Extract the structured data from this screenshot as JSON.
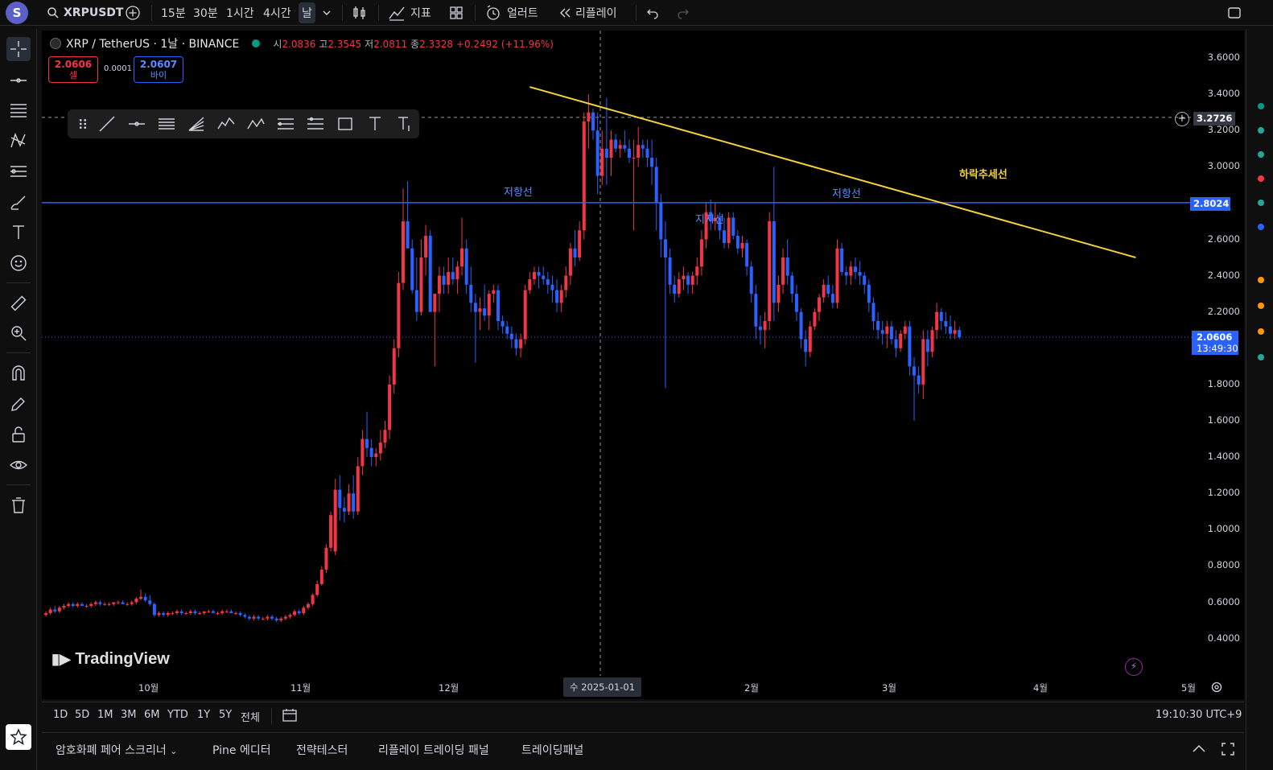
{
  "topbar": {
    "avatar": "S",
    "symbol": "XRPUSDT",
    "intervals": [
      "15분",
      "30분",
      "1시간",
      "4시간",
      "날"
    ],
    "indicators_label": "지표",
    "alert_label": "얼러트",
    "replay_label": "리플레이"
  },
  "legend": {
    "symbol": "XRP / TetherUS · 1날 · BINANCE",
    "open_label": "시",
    "open": "2.0836",
    "high_label": "고",
    "high": "2.3545",
    "low_label": "저",
    "low": "2.0811",
    "close_label": "종",
    "close": "2.3328",
    "change": "+0.2492 (+11.96%)"
  },
  "trade": {
    "sell_price": "2.0606",
    "sell_label": "셀",
    "spread": "0.0001",
    "buy_price": "2.0607",
    "buy_label": "바이"
  },
  "annotations": {
    "resistance_1": "저항선",
    "resistance_2": "저항선",
    "support": "지지선",
    "downtrend": "하락추세선"
  },
  "logo": "TradingView",
  "price_axis": [
    "3.6000",
    "3.4000",
    "3.2000",
    "3.0000",
    "2.6000",
    "2.4000",
    "2.2000",
    "1.8000",
    "1.6000",
    "1.4000",
    "1.2000",
    "1.0000",
    "0.8000",
    "0.6000",
    "0.4000"
  ],
  "price_badges": {
    "crosshair": "3.2726",
    "hline": "2.8024",
    "last": "2.0606",
    "countdown": "13:49:30"
  },
  "time_axis": [
    "10월",
    "11월",
    "12월",
    "수 2025-01-01",
    "2월",
    "3월",
    "4월",
    "5월"
  ],
  "ranges": [
    "1D",
    "5D",
    "1M",
    "3M",
    "6M",
    "YTD",
    "1Y",
    "5Y",
    "전체"
  ],
  "clock": "19:10:30 UTC+9",
  "bottom_tabs": [
    "암호화폐 페어 스크리너",
    "Pine 에디터",
    "전략테스터",
    "리플레이 트레이딩 패널",
    "트레이딩패널"
  ],
  "colors": {
    "up": "#f23645",
    "down": "#2962ff",
    "hline": "#2962ff",
    "trendline": "#f5d33c",
    "annotation_blue": "#5b8cff",
    "annotation_yellow": "#f5d33c"
  },
  "chart_data": {
    "type": "candlestick",
    "symbol": "XRP / TetherUS",
    "interval": "1D",
    "ylim": [
      0.3,
      3.75
    ],
    "horizontal_line": 2.8024,
    "trendline": {
      "from": {
        "t": 107,
        "price": 3.44
      },
      "to": {
        "t": 241,
        "price": 2.5
      }
    },
    "candles": [
      [
        0.53,
        0.55,
        0.52,
        0.54
      ],
      [
        0.54,
        0.57,
        0.53,
        0.56
      ],
      [
        0.56,
        0.58,
        0.54,
        0.55
      ],
      [
        0.55,
        0.58,
        0.54,
        0.57
      ],
      [
        0.57,
        0.59,
        0.56,
        0.58
      ],
      [
        0.58,
        0.6,
        0.57,
        0.59
      ],
      [
        0.59,
        0.6,
        0.57,
        0.58
      ],
      [
        0.58,
        0.6,
        0.57,
        0.59
      ],
      [
        0.59,
        0.6,
        0.58,
        0.58
      ],
      [
        0.58,
        0.59,
        0.57,
        0.58
      ],
      [
        0.58,
        0.6,
        0.57,
        0.59
      ],
      [
        0.59,
        0.61,
        0.58,
        0.6
      ],
      [
        0.6,
        0.61,
        0.58,
        0.59
      ],
      [
        0.59,
        0.6,
        0.58,
        0.59
      ],
      [
        0.59,
        0.6,
        0.58,
        0.59
      ],
      [
        0.59,
        0.6,
        0.58,
        0.6
      ],
      [
        0.6,
        0.61,
        0.59,
        0.6
      ],
      [
        0.6,
        0.61,
        0.59,
        0.59
      ],
      [
        0.59,
        0.6,
        0.58,
        0.59
      ],
      [
        0.59,
        0.61,
        0.58,
        0.6
      ],
      [
        0.6,
        0.63,
        0.59,
        0.62
      ],
      [
        0.62,
        0.67,
        0.61,
        0.63
      ],
      [
        0.63,
        0.65,
        0.6,
        0.61
      ],
      [
        0.61,
        0.64,
        0.58,
        0.59
      ],
      [
        0.59,
        0.6,
        0.52,
        0.53
      ],
      [
        0.53,
        0.55,
        0.52,
        0.54
      ],
      [
        0.54,
        0.55,
        0.52,
        0.53
      ],
      [
        0.53,
        0.55,
        0.52,
        0.54
      ],
      [
        0.54,
        0.55,
        0.53,
        0.54
      ],
      [
        0.54,
        0.56,
        0.53,
        0.55
      ],
      [
        0.55,
        0.56,
        0.53,
        0.54
      ],
      [
        0.54,
        0.55,
        0.53,
        0.54
      ],
      [
        0.54,
        0.56,
        0.53,
        0.55
      ],
      [
        0.55,
        0.56,
        0.53,
        0.54
      ],
      [
        0.54,
        0.55,
        0.53,
        0.54
      ],
      [
        0.54,
        0.55,
        0.53,
        0.55
      ],
      [
        0.55,
        0.56,
        0.54,
        0.55
      ],
      [
        0.55,
        0.56,
        0.54,
        0.54
      ],
      [
        0.54,
        0.55,
        0.53,
        0.54
      ],
      [
        0.54,
        0.56,
        0.53,
        0.55
      ],
      [
        0.55,
        0.56,
        0.54,
        0.55
      ],
      [
        0.55,
        0.56,
        0.54,
        0.54
      ],
      [
        0.54,
        0.55,
        0.53,
        0.54
      ],
      [
        0.54,
        0.55,
        0.52,
        0.53
      ],
      [
        0.53,
        0.54,
        0.51,
        0.52
      ],
      [
        0.52,
        0.53,
        0.5,
        0.51
      ],
      [
        0.51,
        0.53,
        0.5,
        0.52
      ],
      [
        0.52,
        0.53,
        0.5,
        0.51
      ],
      [
        0.51,
        0.52,
        0.5,
        0.51
      ],
      [
        0.51,
        0.53,
        0.5,
        0.52
      ],
      [
        0.52,
        0.53,
        0.5,
        0.51
      ],
      [
        0.51,
        0.52,
        0.49,
        0.5
      ],
      [
        0.5,
        0.52,
        0.49,
        0.51
      ],
      [
        0.51,
        0.53,
        0.5,
        0.52
      ],
      [
        0.52,
        0.54,
        0.51,
        0.53
      ],
      [
        0.53,
        0.56,
        0.52,
        0.55
      ],
      [
        0.55,
        0.56,
        0.53,
        0.54
      ],
      [
        0.54,
        0.58,
        0.53,
        0.57
      ],
      [
        0.57,
        0.6,
        0.56,
        0.59
      ],
      [
        0.59,
        0.65,
        0.58,
        0.64
      ],
      [
        0.64,
        0.72,
        0.63,
        0.7
      ],
      [
        0.7,
        0.8,
        0.69,
        0.78
      ],
      [
        0.78,
        0.92,
        0.76,
        0.9
      ],
      [
        0.9,
        1.1,
        0.88,
        1.08
      ],
      [
        0.88,
        1.28,
        0.86,
        1.22
      ],
      [
        1.22,
        1.3,
        1.05,
        1.12
      ],
      [
        1.12,
        1.18,
        1.04,
        1.1
      ],
      [
        1.1,
        1.25,
        1.08,
        1.2
      ],
      [
        1.2,
        1.3,
        1.06,
        1.1
      ],
      [
        1.1,
        1.4,
        1.08,
        1.35
      ],
      [
        1.35,
        1.55,
        1.3,
        1.5
      ],
      [
        1.5,
        1.65,
        1.4,
        1.45
      ],
      [
        1.45,
        1.5,
        1.35,
        1.4
      ],
      [
        1.4,
        1.45,
        1.35,
        1.42
      ],
      [
        1.42,
        1.55,
        1.38,
        1.48
      ],
      [
        1.48,
        1.6,
        1.45,
        1.55
      ],
      [
        1.55,
        1.85,
        1.5,
        1.8
      ],
      [
        1.8,
        2.05,
        1.75,
        2.0
      ],
      [
        2.0,
        2.42,
        1.95,
        2.36
      ],
      [
        2.36,
        2.88,
        2.32,
        2.7
      ],
      [
        2.7,
        2.92,
        2.58,
        2.55
      ],
      [
        2.55,
        2.6,
        2.3,
        2.32
      ],
      [
        2.32,
        2.5,
        2.15,
        2.2
      ],
      [
        2.2,
        2.6,
        2.18,
        2.5
      ],
      [
        2.5,
        2.68,
        2.4,
        2.62
      ],
      [
        2.62,
        2.65,
        2.2,
        2.2
      ],
      [
        2.2,
        2.3,
        1.9,
        2.3
      ],
      [
        2.3,
        2.45,
        2.2,
        2.4
      ],
      [
        2.4,
        2.45,
        2.3,
        2.35
      ],
      [
        2.35,
        2.5,
        2.3,
        2.42
      ],
      [
        2.42,
        2.5,
        2.35,
        2.38
      ],
      [
        2.38,
        2.48,
        2.3,
        2.45
      ],
      [
        2.45,
        2.72,
        2.4,
        2.55
      ],
      [
        2.55,
        2.6,
        2.3,
        2.35
      ],
      [
        2.35,
        2.45,
        2.2,
        2.25
      ],
      [
        2.25,
        2.3,
        1.92,
        2.2
      ],
      [
        2.2,
        2.28,
        2.1,
        2.22
      ],
      [
        2.22,
        2.35,
        2.15,
        2.18
      ],
      [
        2.18,
        2.32,
        2.1,
        2.3
      ],
      [
        2.3,
        2.35,
        2.25,
        2.32
      ],
      [
        2.32,
        2.35,
        2.1,
        2.15
      ],
      [
        2.15,
        2.18,
        2.08,
        2.12
      ],
      [
        2.12,
        2.15,
        2.05,
        2.08
      ],
      [
        2.08,
        2.12,
        2.0,
        2.05
      ],
      [
        2.05,
        2.08,
        1.96,
        2.0
      ],
      [
        2.0,
        2.08,
        1.95,
        2.05
      ],
      [
        2.05,
        2.35,
        2.02,
        2.32
      ],
      [
        2.32,
        2.42,
        2.3,
        2.38
      ],
      [
        2.38,
        2.45,
        2.35,
        2.42
      ],
      [
        2.42,
        2.45,
        2.33,
        2.4
      ],
      [
        2.4,
        2.45,
        2.35,
        2.38
      ],
      [
        2.38,
        2.42,
        2.3,
        2.35
      ],
      [
        2.35,
        2.4,
        2.25,
        2.32
      ],
      [
        2.32,
        2.38,
        2.2,
        2.25
      ],
      [
        2.25,
        2.35,
        2.2,
        2.32
      ],
      [
        2.32,
        2.45,
        2.28,
        2.4
      ],
      [
        2.4,
        2.58,
        2.35,
        2.55
      ],
      [
        2.55,
        2.65,
        2.45,
        2.5
      ],
      [
        2.5,
        2.7,
        2.48,
        2.65
      ],
      [
        2.65,
        3.3,
        2.6,
        3.25
      ],
      [
        3.25,
        3.4,
        3.1,
        3.3
      ],
      [
        3.3,
        3.32,
        3.15,
        3.2
      ],
      [
        3.2,
        3.3,
        2.85,
        2.95
      ],
      [
        2.95,
        3.2,
        2.9,
        3.1
      ],
      [
        3.1,
        3.38,
        2.9,
        3.05
      ],
      [
        3.05,
        3.2,
        2.95,
        3.15
      ],
      [
        3.15,
        3.18,
        3.08,
        3.1
      ],
      [
        3.1,
        3.15,
        3.05,
        3.12
      ],
      [
        3.12,
        3.2,
        3.08,
        3.1
      ],
      [
        3.1,
        3.15,
        3.02,
        3.05
      ],
      [
        3.05,
        3.15,
        2.65,
        3.05
      ],
      [
        3.05,
        3.22,
        3.0,
        3.12
      ],
      [
        3.12,
        3.15,
        3.05,
        3.1
      ],
      [
        3.1,
        3.15,
        3.0,
        3.05
      ],
      [
        3.05,
        3.15,
        2.9,
        3.0
      ],
      [
        3.0,
        3.05,
        2.65,
        2.8
      ],
      [
        2.8,
        2.85,
        2.5,
        2.6
      ],
      [
        2.6,
        2.7,
        1.78,
        2.5
      ],
      [
        2.5,
        2.55,
        2.3,
        2.35
      ],
      [
        2.35,
        2.4,
        2.25,
        2.3
      ],
      [
        2.3,
        2.42,
        2.28,
        2.38
      ],
      [
        2.38,
        2.45,
        2.32,
        2.4
      ],
      [
        2.4,
        2.42,
        2.3,
        2.35
      ],
      [
        2.35,
        2.42,
        2.3,
        2.4
      ],
      [
        2.4,
        2.5,
        2.35,
        2.45
      ],
      [
        2.45,
        2.65,
        2.4,
        2.6
      ],
      [
        2.6,
        2.8,
        2.55,
        2.75
      ],
      [
        2.75,
        2.82,
        2.65,
        2.7
      ],
      [
        2.7,
        2.8,
        2.65,
        2.72
      ],
      [
        2.72,
        2.75,
        2.6,
        2.65
      ],
      [
        2.65,
        2.72,
        2.55,
        2.58
      ],
      [
        2.58,
        2.75,
        2.55,
        2.72
      ],
      [
        2.72,
        2.75,
        2.6,
        2.62
      ],
      [
        2.62,
        2.65,
        2.52,
        2.55
      ],
      [
        2.55,
        2.62,
        2.5,
        2.58
      ],
      [
        2.58,
        2.6,
        2.4,
        2.45
      ],
      [
        2.45,
        2.48,
        2.25,
        2.3
      ],
      [
        2.3,
        2.35,
        2.05,
        2.12
      ],
      [
        2.12,
        2.18,
        2.02,
        2.1
      ],
      [
        2.1,
        2.2,
        2.0,
        2.15
      ],
      [
        2.15,
        2.75,
        2.1,
        2.7
      ],
      [
        2.7,
        3.0,
        2.15,
        2.25
      ],
      [
        2.25,
        2.4,
        2.2,
        2.35
      ],
      [
        2.35,
        2.55,
        2.3,
        2.5
      ],
      [
        2.5,
        2.6,
        2.35,
        2.4
      ],
      [
        2.4,
        2.42,
        2.25,
        2.3
      ],
      [
        2.3,
        2.35,
        2.15,
        2.2
      ],
      [
        2.2,
        2.22,
        2.0,
        2.05
      ],
      [
        2.05,
        2.1,
        1.9,
        1.98
      ],
      [
        1.98,
        2.15,
        1.95,
        2.12
      ],
      [
        2.12,
        2.22,
        2.1,
        2.2
      ],
      [
        2.2,
        2.3,
        2.15,
        2.28
      ],
      [
        2.28,
        2.38,
        2.25,
        2.35
      ],
      [
        2.35,
        2.4,
        2.28,
        2.3
      ],
      [
        2.3,
        2.35,
        2.22,
        2.25
      ],
      [
        2.25,
        2.6,
        2.22,
        2.55
      ],
      [
        2.55,
        2.58,
        2.4,
        2.42
      ],
      [
        2.42,
        2.45,
        2.35,
        2.4
      ],
      [
        2.4,
        2.48,
        2.35,
        2.45
      ],
      [
        2.45,
        2.5,
        2.38,
        2.42
      ],
      [
        2.42,
        2.48,
        2.35,
        2.4
      ],
      [
        2.4,
        2.42,
        2.3,
        2.35
      ],
      [
        2.35,
        2.38,
        2.2,
        2.25
      ],
      [
        2.25,
        2.28,
        2.1,
        2.15
      ],
      [
        2.15,
        2.2,
        2.05,
        2.1
      ],
      [
        2.1,
        2.15,
        2.02,
        2.08
      ],
      [
        2.08,
        2.15,
        2.0,
        2.12
      ],
      [
        2.12,
        2.15,
        2.02,
        2.05
      ],
      [
        2.05,
        2.1,
        1.95,
        2.0
      ],
      [
        2.0,
        2.1,
        1.98,
        2.08
      ],
      [
        2.08,
        2.15,
        2.05,
        2.12
      ],
      [
        2.12,
        2.15,
        1.85,
        1.9
      ],
      [
        1.9,
        1.95,
        1.6,
        1.85
      ],
      [
        1.85,
        1.9,
        1.75,
        1.8
      ],
      [
        1.8,
        2.1,
        1.72,
        2.05
      ],
      [
        2.05,
        2.1,
        1.9,
        1.98
      ],
      [
        1.98,
        2.12,
        1.95,
        2.1
      ],
      [
        2.1,
        2.25,
        2.05,
        2.2
      ],
      [
        2.2,
        2.22,
        2.1,
        2.15
      ],
      [
        2.15,
        2.2,
        2.08,
        2.12
      ],
      [
        2.12,
        2.18,
        2.05,
        2.08
      ],
      [
        2.08,
        2.15,
        2.05,
        2.1
      ],
      [
        2.1,
        2.12,
        2.05,
        2.06
      ]
    ]
  }
}
